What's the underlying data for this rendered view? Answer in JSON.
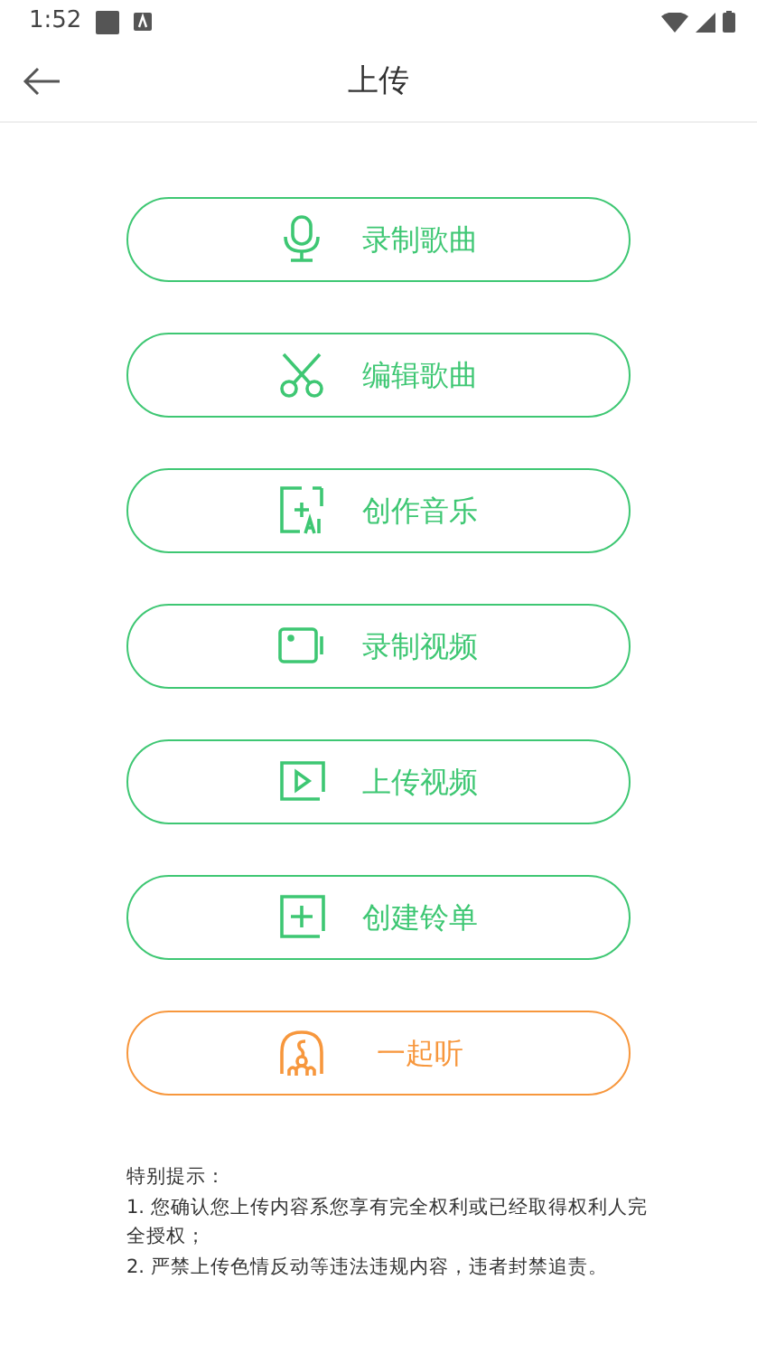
{
  "status_bar": {
    "time": "1:52"
  },
  "header": {
    "title": "上传"
  },
  "actions": [
    {
      "label": "录制歌曲",
      "color": "#3ec773"
    },
    {
      "label": "编辑歌曲",
      "color": "#3ec773"
    },
    {
      "label": "创作音乐",
      "color": "#3ec773"
    },
    {
      "label": "录制视频",
      "color": "#3ec773"
    },
    {
      "label": "上传视频",
      "color": "#3ec773"
    },
    {
      "label": "创建铃单",
      "color": "#3ec773"
    },
    {
      "label": "一起听",
      "color": "#f7973d"
    }
  ],
  "notice": {
    "title": "特别提示：",
    "lines": [
      "1. 您确认您上传内容系您享有完全权利或已经取得权利人完全授权；",
      "2. 严禁上传色情反动等违法违规内容，违者封禁追责。"
    ]
  }
}
